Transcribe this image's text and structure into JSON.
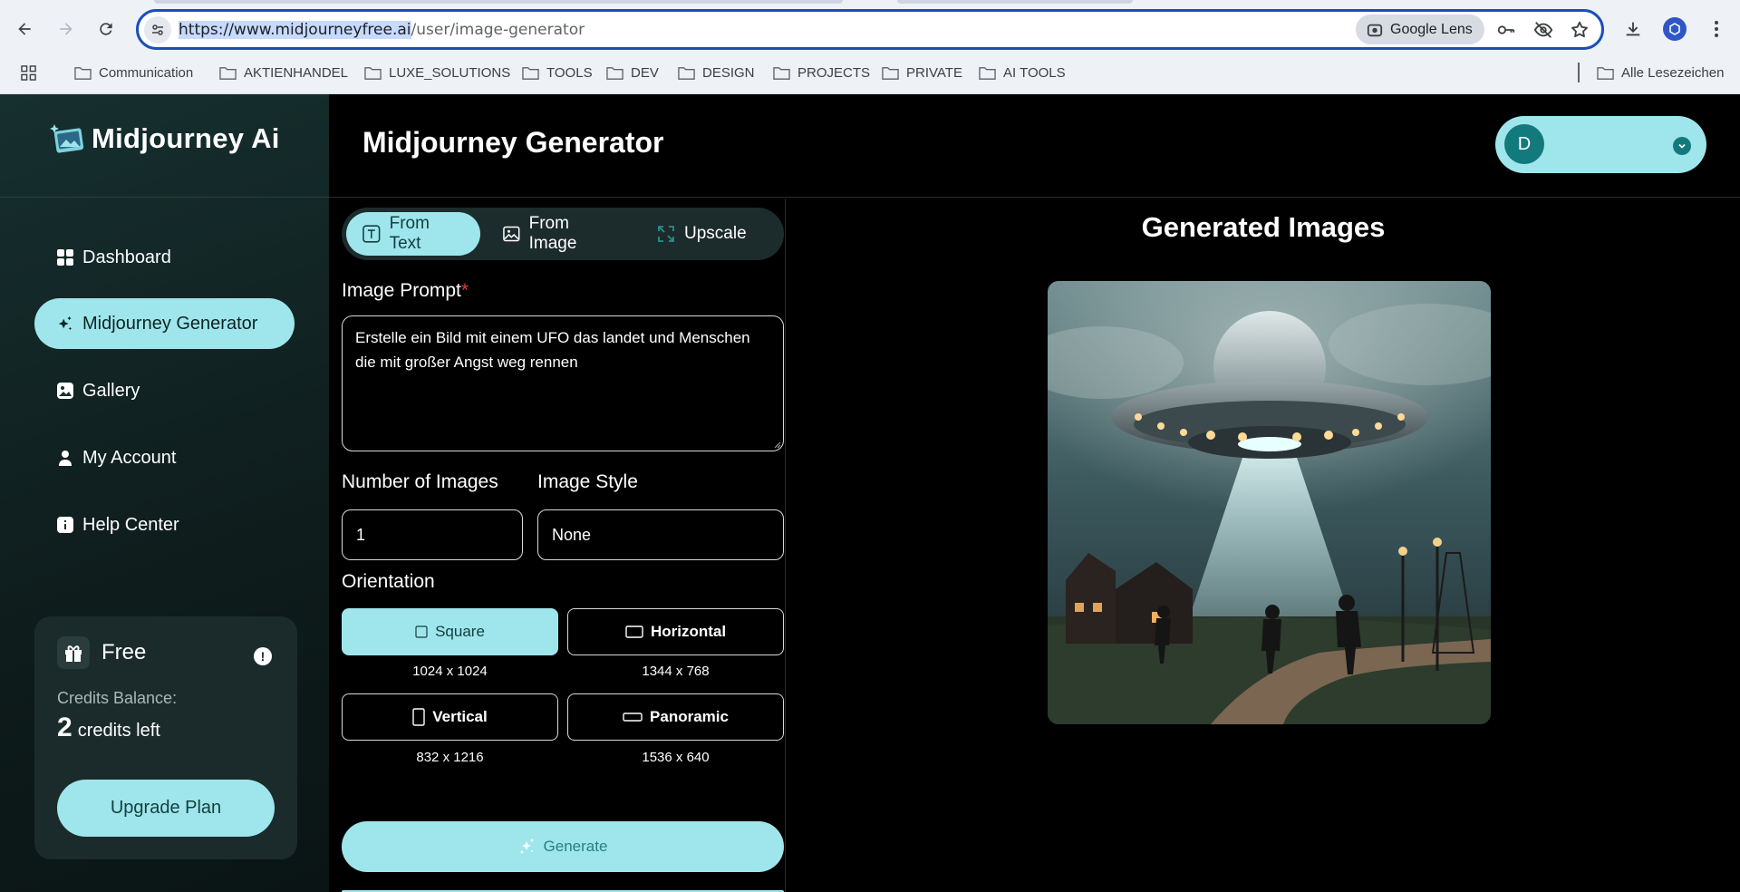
{
  "browser": {
    "url_selected": "https://www.midjourneyfree.ai",
    "url_rest": "/user/image-generator",
    "lens_label": "Google Lens",
    "bookmarks": [
      "Communication",
      "AKTIENHANDEL",
      "LUXE_SOLUTIONS",
      "TOOLS",
      "DEV",
      "DESIGN",
      "PROJECTS",
      "PRIVATE",
      "AI TOOLS"
    ],
    "all_bookmarks": "Alle Lesezeichen"
  },
  "sidebar": {
    "logo_text": "Midjourney Ai",
    "items": [
      {
        "label": "Dashboard",
        "icon": "dashboard-icon"
      },
      {
        "label": "Midjourney Generator",
        "icon": "sparkle-icon",
        "active": true
      },
      {
        "label": "Gallery",
        "icon": "image-icon"
      },
      {
        "label": "My Account",
        "icon": "user-icon"
      },
      {
        "label": "Help Center",
        "icon": "info-icon"
      }
    ],
    "plan": {
      "name": "Free",
      "credits_label": "Credits Balance:",
      "credits_value": "2",
      "credits_suffix": "credits left",
      "upgrade_label": "Upgrade Plan"
    }
  },
  "header": {
    "title": "Midjourney Generator",
    "avatar_initial": "D"
  },
  "form": {
    "tabs": [
      {
        "label": "From Text",
        "icon": "text-icon",
        "active": true
      },
      {
        "label": "From Image",
        "icon": "image-icon"
      },
      {
        "label": "Upscale",
        "icon": "upscale-icon"
      }
    ],
    "prompt_label": "Image Prompt",
    "required_mark": "*",
    "prompt_value": "Erstelle ein Bild mit einem UFO das landet und Menschen die mit großer Angst weg rennen",
    "num_images_label": "Number of Images",
    "num_images_value": "1",
    "style_label": "Image Style",
    "style_value": "None",
    "orientation_label": "Orientation",
    "orientations": [
      {
        "label": "Square",
        "dims": "1024 x 1024",
        "active": true
      },
      {
        "label": "Horizontal",
        "dims": "1344 x 768"
      },
      {
        "label": "Vertical",
        "dims": "832 x 1216"
      },
      {
        "label": "Panoramic",
        "dims": "1536 x 640"
      }
    ],
    "generate_label": "Generate"
  },
  "results": {
    "title": "Generated Images"
  },
  "colors": {
    "accent": "#9fe6ec",
    "accent_text": "#13403f",
    "required": "#e23b3b",
    "omnibox_border": "#1a4fb9"
  }
}
